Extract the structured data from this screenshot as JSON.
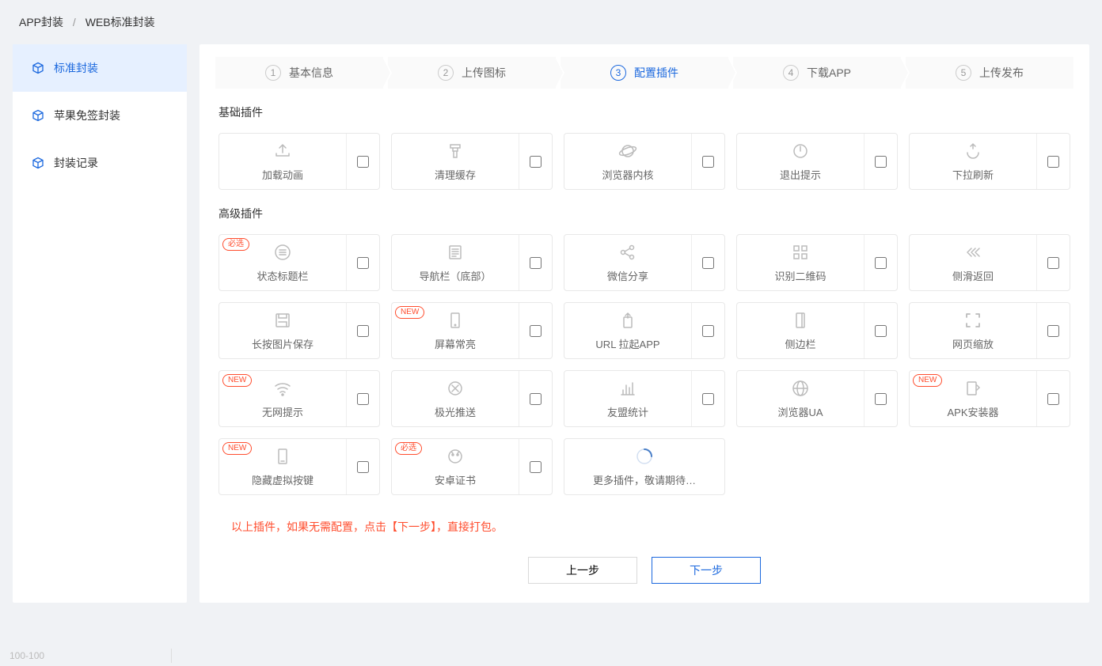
{
  "breadcrumb": {
    "a": "APP封装",
    "b": "WEB标准封装"
  },
  "sidebar": {
    "items": [
      {
        "label": "标准封装"
      },
      {
        "label": "苹果免签封装"
      },
      {
        "label": "封装记录"
      }
    ]
  },
  "steps": [
    {
      "num": "1",
      "label": "基本信息"
    },
    {
      "num": "2",
      "label": "上传图标"
    },
    {
      "num": "3",
      "label": "配置插件"
    },
    {
      "num": "4",
      "label": "下载APP"
    },
    {
      "num": "5",
      "label": "上传发布"
    }
  ],
  "sections": {
    "basic": {
      "title": "基础插件",
      "items": [
        {
          "label": "加载动画",
          "icon": "upload"
        },
        {
          "label": "清理缓存",
          "icon": "brush"
        },
        {
          "label": "浏览器内核",
          "icon": "planet"
        },
        {
          "label": "退出提示",
          "icon": "power"
        },
        {
          "label": "下拉刷新",
          "icon": "refresh"
        }
      ]
    },
    "advanced": {
      "title": "高级插件",
      "items": [
        {
          "label": "状态标题栏",
          "icon": "list",
          "badge": "必选"
        },
        {
          "label": "导航栏（底部）",
          "icon": "nav"
        },
        {
          "label": "微信分享",
          "icon": "share"
        },
        {
          "label": "识别二维码",
          "icon": "qr"
        },
        {
          "label": "侧滑返回",
          "icon": "swipe"
        },
        {
          "label": "长按图片保存",
          "icon": "save"
        },
        {
          "label": "屏幕常亮",
          "icon": "screen",
          "badge": "NEW"
        },
        {
          "label": "URL 拉起APP",
          "icon": "launch"
        },
        {
          "label": "侧边栏",
          "icon": "sidebar"
        },
        {
          "label": "网页缩放",
          "icon": "zoom"
        },
        {
          "label": "无网提示",
          "icon": "wifi",
          "badge": "NEW"
        },
        {
          "label": "极光推送",
          "icon": "push"
        },
        {
          "label": "友盟统计",
          "icon": "stats"
        },
        {
          "label": "浏览器UA",
          "icon": "globe"
        },
        {
          "label": "APK安装器",
          "icon": "apk",
          "badge": "NEW"
        },
        {
          "label": "隐藏虚拟按键",
          "icon": "phone",
          "badge": "NEW"
        },
        {
          "label": "安卓证书",
          "icon": "android",
          "badge": "必选"
        },
        {
          "label": "更多插件，敬请期待…",
          "icon": "loading",
          "nocheck": true
        }
      ]
    }
  },
  "tip": "以上插件，如果无需配置，点击【下一步】，直接打包。",
  "actions": {
    "prev": "上一步",
    "next": "下一步"
  },
  "footer": {
    "text": "100-100"
  }
}
